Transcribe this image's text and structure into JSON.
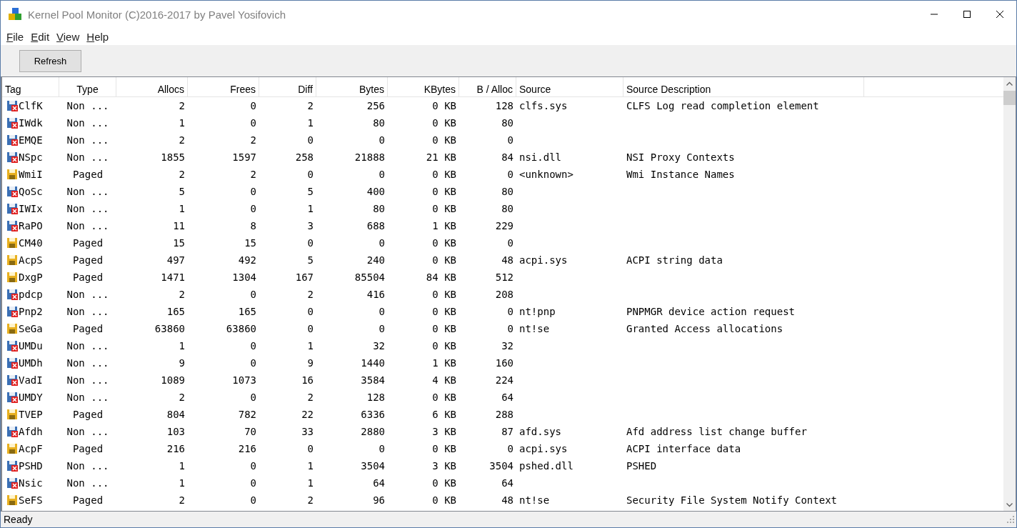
{
  "window": {
    "title": "Kernel Pool Monitor (C)2016-2017 by Pavel Yosifovich"
  },
  "menu": [
    "File",
    "Edit",
    "View",
    "Help"
  ],
  "toolbar": {
    "buttons": [
      "Refresh"
    ]
  },
  "table": {
    "columns": [
      "Tag",
      "Type",
      "Allocs",
      "Frees",
      "Diff",
      "Bytes",
      "KBytes",
      "B / Alloc",
      "Source",
      "Source Description"
    ],
    "rows": [
      {
        "kind": "nonpaged",
        "tag": "ClfK",
        "type": "Non ...",
        "allocs": "2",
        "frees": "0",
        "diff": "2",
        "bytes": "256",
        "kbytes": "0 KB",
        "per_alloc": "128",
        "source": "clfs.sys",
        "description": "CLFS Log read completion element"
      },
      {
        "kind": "nonpaged",
        "tag": "IWdk",
        "type": "Non ...",
        "allocs": "1",
        "frees": "0",
        "diff": "1",
        "bytes": "80",
        "kbytes": "0 KB",
        "per_alloc": "80"
      },
      {
        "kind": "nonpaged",
        "tag": "EMQE",
        "type": "Non ...",
        "allocs": "2",
        "frees": "2",
        "diff": "0",
        "bytes": "0",
        "kbytes": "0 KB",
        "per_alloc": "0"
      },
      {
        "kind": "nonpaged",
        "tag": "NSpc",
        "type": "Non ...",
        "allocs": "1855",
        "frees": "1597",
        "diff": "258",
        "bytes": "21888",
        "kbytes": "21 KB",
        "per_alloc": "84",
        "source": "nsi.dll",
        "description": "NSI Proxy Contexts"
      },
      {
        "kind": "paged",
        "tag": "WmiI",
        "type": "Paged",
        "allocs": "2",
        "frees": "2",
        "diff": "0",
        "bytes": "0",
        "kbytes": "0 KB",
        "per_alloc": "0",
        "source": "<unknown>",
        "description": "Wmi Instance Names"
      },
      {
        "kind": "nonpaged",
        "tag": "QoSc",
        "type": "Non ...",
        "allocs": "5",
        "frees": "0",
        "diff": "5",
        "bytes": "400",
        "kbytes": "0 KB",
        "per_alloc": "80"
      },
      {
        "kind": "nonpaged",
        "tag": "IWIx",
        "type": "Non ...",
        "allocs": "1",
        "frees": "0",
        "diff": "1",
        "bytes": "80",
        "kbytes": "0 KB",
        "per_alloc": "80"
      },
      {
        "kind": "nonpaged",
        "tag": "RaPO",
        "type": "Non ...",
        "allocs": "11",
        "frees": "8",
        "diff": "3",
        "bytes": "688",
        "kbytes": "1 KB",
        "per_alloc": "229"
      },
      {
        "kind": "paged",
        "tag": "CM40",
        "type": "Paged",
        "allocs": "15",
        "frees": "15",
        "diff": "0",
        "bytes": "0",
        "kbytes": "0 KB",
        "per_alloc": "0"
      },
      {
        "kind": "paged",
        "tag": "AcpS",
        "type": "Paged",
        "allocs": "497",
        "frees": "492",
        "diff": "5",
        "bytes": "240",
        "kbytes": "0 KB",
        "per_alloc": "48",
        "source": "acpi.sys",
        "description": "ACPI string data"
      },
      {
        "kind": "paged",
        "tag": "DxgP",
        "type": "Paged",
        "allocs": "1471",
        "frees": "1304",
        "diff": "167",
        "bytes": "85504",
        "kbytes": "84 KB",
        "per_alloc": "512"
      },
      {
        "kind": "nonpaged",
        "tag": "pdcp",
        "type": "Non ...",
        "allocs": "2",
        "frees": "0",
        "diff": "2",
        "bytes": "416",
        "kbytes": "0 KB",
        "per_alloc": "208"
      },
      {
        "kind": "nonpaged",
        "tag": "Pnp2",
        "type": "Non ...",
        "allocs": "165",
        "frees": "165",
        "diff": "0",
        "bytes": "0",
        "kbytes": "0 KB",
        "per_alloc": "0",
        "source": "nt!pnp",
        "description": "PNPMGR device action request"
      },
      {
        "kind": "paged",
        "tag": "SeGa",
        "type": "Paged",
        "allocs": "63860",
        "frees": "63860",
        "diff": "0",
        "bytes": "0",
        "kbytes": "0 KB",
        "per_alloc": "0",
        "source": "nt!se",
        "description": "Granted Access allocations"
      },
      {
        "kind": "nonpaged",
        "tag": "UMDu",
        "type": "Non ...",
        "allocs": "1",
        "frees": "0",
        "diff": "1",
        "bytes": "32",
        "kbytes": "0 KB",
        "per_alloc": "32"
      },
      {
        "kind": "nonpaged",
        "tag": "UMDh",
        "type": "Non ...",
        "allocs": "9",
        "frees": "0",
        "diff": "9",
        "bytes": "1440",
        "kbytes": "1 KB",
        "per_alloc": "160"
      },
      {
        "kind": "nonpaged",
        "tag": "VadI",
        "type": "Non ...",
        "allocs": "1089",
        "frees": "1073",
        "diff": "16",
        "bytes": "3584",
        "kbytes": "4 KB",
        "per_alloc": "224"
      },
      {
        "kind": "nonpaged",
        "tag": "UMDY",
        "type": "Non ...",
        "allocs": "2",
        "frees": "0",
        "diff": "2",
        "bytes": "128",
        "kbytes": "0 KB",
        "per_alloc": "64"
      },
      {
        "kind": "paged",
        "tag": "TVEP",
        "type": "Paged",
        "allocs": "804",
        "frees": "782",
        "diff": "22",
        "bytes": "6336",
        "kbytes": "6 KB",
        "per_alloc": "288"
      },
      {
        "kind": "nonpaged",
        "tag": "Afdh",
        "type": "Non ...",
        "allocs": "103",
        "frees": "70",
        "diff": "33",
        "bytes": "2880",
        "kbytes": "3 KB",
        "per_alloc": "87",
        "source": "afd.sys",
        "description": "Afd address list change buffer"
      },
      {
        "kind": "paged",
        "tag": "AcpF",
        "type": "Paged",
        "allocs": "216",
        "frees": "216",
        "diff": "0",
        "bytes": "0",
        "kbytes": "0 KB",
        "per_alloc": "0",
        "source": "acpi.sys",
        "description": "ACPI interface data"
      },
      {
        "kind": "nonpaged",
        "tag": "PSHD",
        "type": "Non ...",
        "allocs": "1",
        "frees": "0",
        "diff": "1",
        "bytes": "3504",
        "kbytes": "3 KB",
        "per_alloc": "3504",
        "source": "pshed.dll",
        "description": "PSHED"
      },
      {
        "kind": "nonpaged",
        "tag": "Nsic",
        "type": "Non ...",
        "allocs": "1",
        "frees": "0",
        "diff": "1",
        "bytes": "64",
        "kbytes": "0 KB",
        "per_alloc": "64"
      },
      {
        "kind": "paged",
        "tag": "SeFS",
        "type": "Paged",
        "allocs": "2",
        "frees": "0",
        "diff": "2",
        "bytes": "96",
        "kbytes": "0 KB",
        "per_alloc": "48",
        "source": "nt!se",
        "description": "Security File System Notify Context"
      }
    ]
  },
  "status_bar": {
    "text": "Ready"
  }
}
